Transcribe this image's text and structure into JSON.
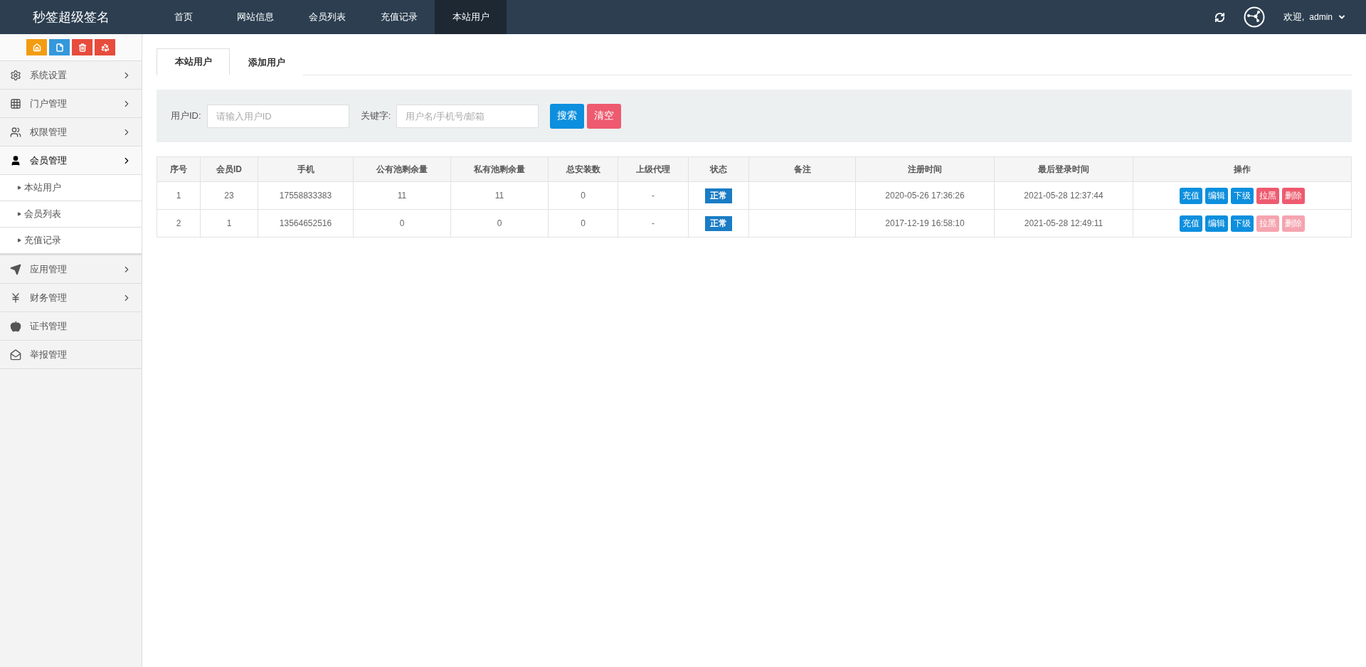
{
  "header": {
    "brand": "秒签超级签名",
    "nav": [
      {
        "label": "首页",
        "selected": false
      },
      {
        "label": "网站信息",
        "selected": false
      },
      {
        "label": "会员列表",
        "selected": false
      },
      {
        "label": "充值记录",
        "selected": false
      },
      {
        "label": "本站用户",
        "selected": true
      }
    ],
    "welcome": "欢迎,",
    "user": "admin"
  },
  "sidebar": {
    "toolbar": [
      {
        "color": "#f39c12"
      },
      {
        "color": "#3498db"
      },
      {
        "color": "#e74c3c"
      },
      {
        "color": "#e74c3c"
      }
    ],
    "items": [
      {
        "label": "系统设置",
        "expandable": true,
        "expanded": false
      },
      {
        "label": "门户管理",
        "expandable": true,
        "expanded": false
      },
      {
        "label": "权限管理",
        "expandable": true,
        "expanded": false
      },
      {
        "label": "会员管理",
        "expandable": true,
        "expanded": true,
        "children": [
          {
            "label": "本站用户"
          },
          {
            "label": "会员列表"
          },
          {
            "label": "充值记录"
          }
        ]
      },
      {
        "label": "应用管理",
        "expandable": true,
        "expanded": false
      },
      {
        "label": "财务管理",
        "expandable": true,
        "expanded": false
      },
      {
        "label": "证书管理",
        "expandable": false,
        "expanded": false
      },
      {
        "label": "举报管理",
        "expandable": false,
        "expanded": false
      }
    ]
  },
  "tabs": [
    {
      "label": "本站用户",
      "selected": true
    },
    {
      "label": "添加用户",
      "selected": false
    }
  ],
  "search": {
    "fields": [
      {
        "label": "用户ID:",
        "placeholder": "请输入用户ID"
      },
      {
        "label": "关键字:",
        "placeholder": "用户名/手机号/邮箱"
      }
    ],
    "buttons": [
      {
        "label": "搜索",
        "kind": "primary"
      },
      {
        "label": "清空",
        "kind": "danger"
      }
    ]
  },
  "table": {
    "columns": [
      "序号",
      "会员ID",
      "手机",
      "公有池剩余量",
      "私有池剩余量",
      "总安装数",
      "上级代理",
      "状态",
      "备注",
      "注册时间",
      "最后登录时间",
      "操作"
    ],
    "rows": [
      {
        "cells": [
          "1",
          "23",
          "17558833383",
          "11",
          "11",
          "0",
          "-"
        ],
        "status": "正常",
        "remark": "",
        "registered": "2020-05-26 17:36:26",
        "last_login": "2021-05-28 12:37:44",
        "actions": [
          {
            "label": "充值",
            "kind": "primary",
            "disabled": false
          },
          {
            "label": "编辑",
            "kind": "primary",
            "disabled": false
          },
          {
            "label": "下级",
            "kind": "primary",
            "disabled": false
          },
          {
            "label": "拉黑",
            "kind": "danger",
            "disabled": false
          },
          {
            "label": "删除",
            "kind": "danger",
            "disabled": false
          }
        ]
      },
      {
        "cells": [
          "2",
          "1",
          "13564652516",
          "0",
          "0",
          "0",
          "-"
        ],
        "status": "正常",
        "remark": "",
        "registered": "2017-12-19 16:58:10",
        "last_login": "2021-05-28 12:49:11",
        "actions": [
          {
            "label": "充值",
            "kind": "primary",
            "disabled": false
          },
          {
            "label": "编辑",
            "kind": "primary",
            "disabled": false
          },
          {
            "label": "下级",
            "kind": "primary",
            "disabled": false
          },
          {
            "label": "拉黑",
            "kind": "danger",
            "disabled": true
          },
          {
            "label": "删除",
            "kind": "danger",
            "disabled": true
          }
        ]
      }
    ]
  }
}
